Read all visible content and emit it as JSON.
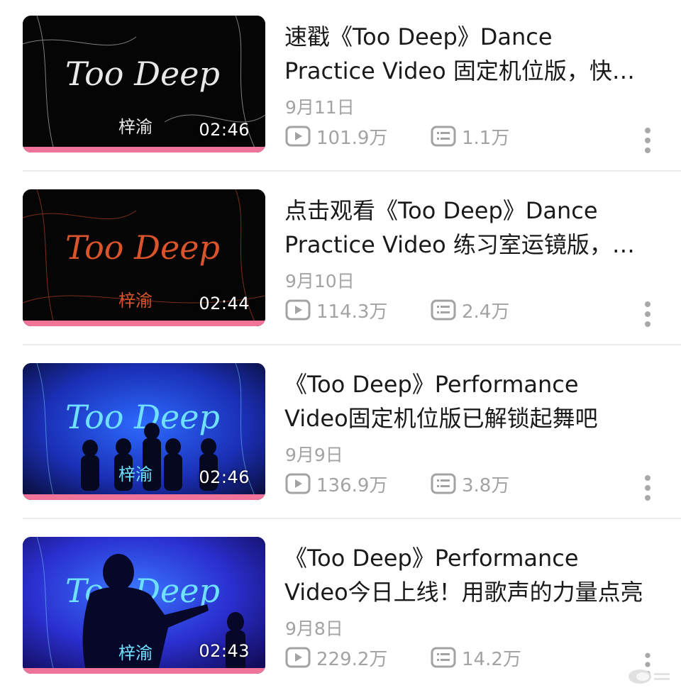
{
  "videos": [
    {
      "title": "速戳《Too Deep》Dance Practice Video 固定机位版，快来看看吧",
      "date": "9月11日",
      "duration": "02:46",
      "plays": "101.9万",
      "comments": "1.1万",
      "thumb_text": "Too Deep",
      "thumb_sig": "梓渝",
      "thumb_theme": "white"
    },
    {
      "title": "点击观看《Too Deep》Dance Practice Video 练习室运镜版，一起来看",
      "date": "9月10日",
      "duration": "02:44",
      "plays": "114.3万",
      "comments": "2.4万",
      "thumb_text": "Too Deep",
      "thumb_sig": "梓渝",
      "thumb_theme": "red"
    },
    {
      "title": "《Too Deep》Performance Video固定机位版已解锁起舞吧",
      "date": "9月9日",
      "duration": "02:46",
      "plays": "136.9万",
      "comments": "3.8万",
      "thumb_text": "Too Deep",
      "thumb_sig": "梓渝",
      "thumb_theme": "blue"
    },
    {
      "title": "《Too Deep》Performance Video今日上线！用歌声的力量点亮",
      "date": "9月8日",
      "duration": "02:43",
      "plays": "229.2万",
      "comments": "14.2万",
      "thumb_text": "Too Deep",
      "thumb_sig": "梓渝",
      "thumb_theme": "blue-figure"
    }
  ],
  "icons": {
    "play_icon": "play-count-icon",
    "comment_icon": "danmaku-count-icon",
    "more_icon": "more-vertical-icon"
  },
  "colors": {
    "progress_bar": "#f0739a",
    "meta_gray": "#a3a3a3",
    "title_text": "#1a1a1a",
    "divider": "#ececec"
  }
}
